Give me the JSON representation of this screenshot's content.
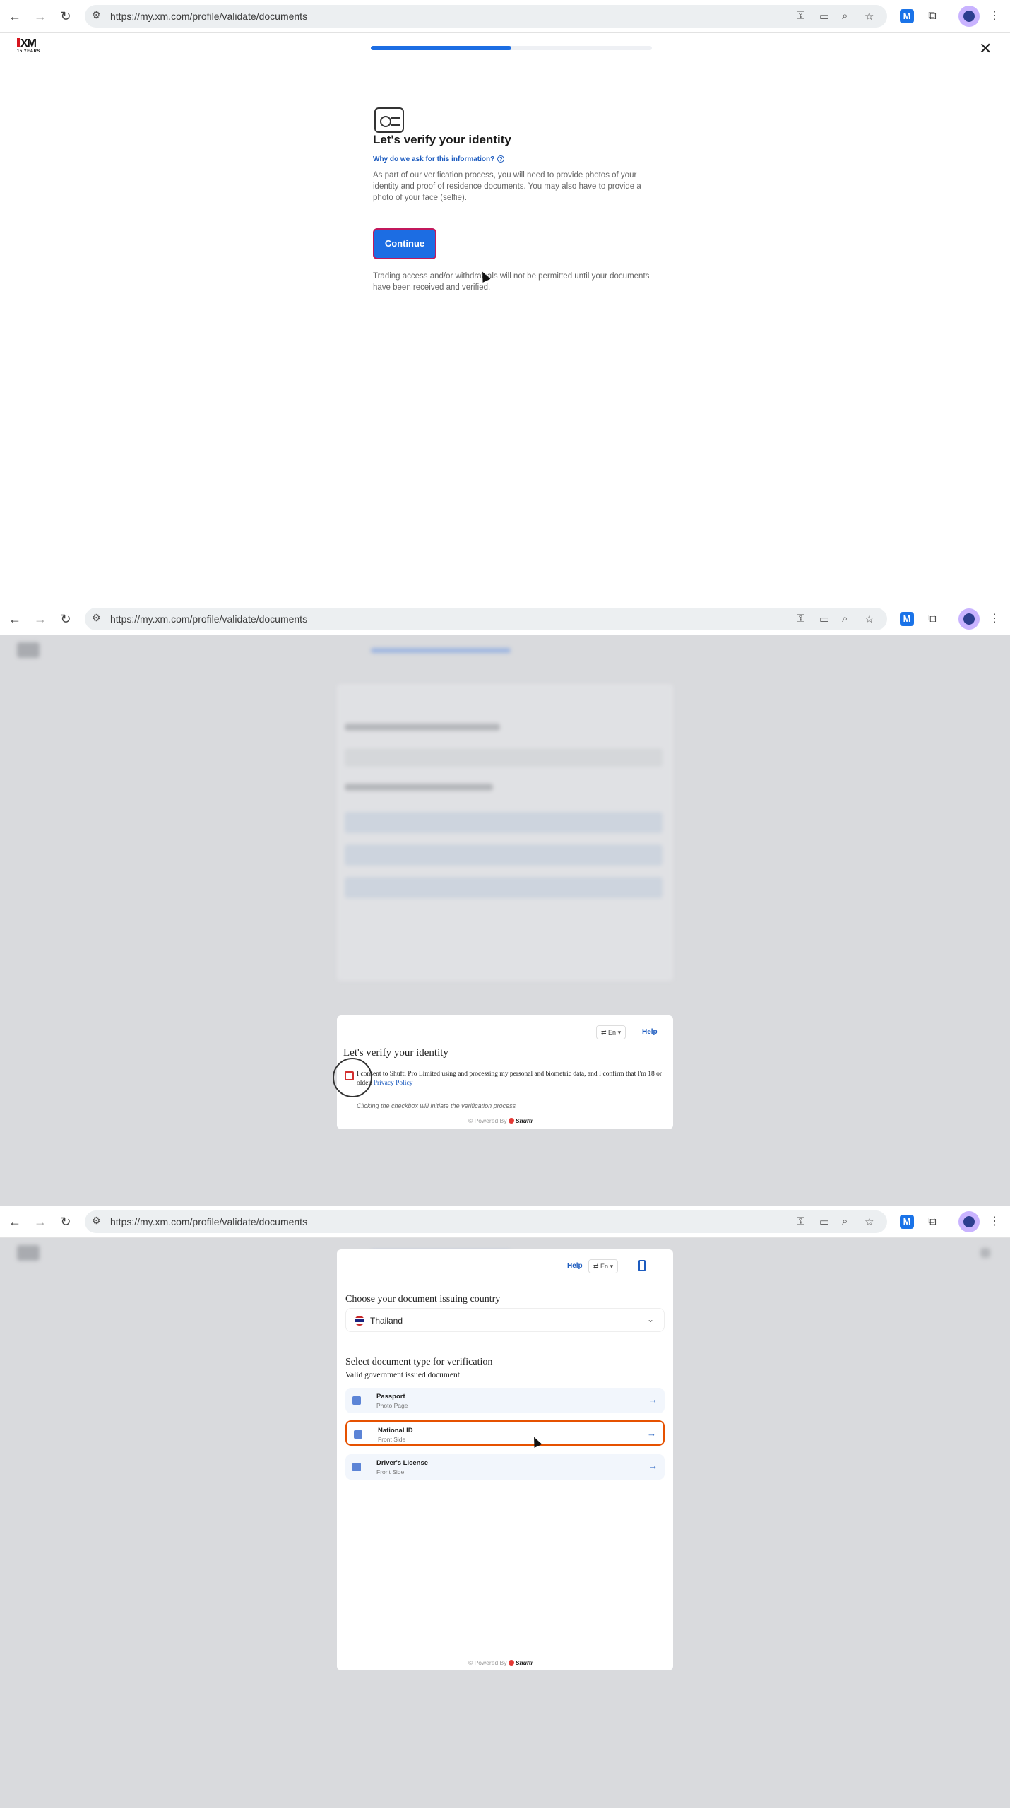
{
  "browser": {
    "url": "https://my.xm.com/profile/validate/documents"
  },
  "xm": {
    "logo_text": "XM",
    "logo_sub": "15 YEARS",
    "progress_percent": 50
  },
  "panel1": {
    "title": "Let's verify your identity",
    "why_link": "Why do we ask for this information?",
    "description": "As part of our verification process, you will need to provide photos of your identity and proof of residence documents. You may also have to provide a photo of your face (selfie).",
    "continue_label": "Continue",
    "note": "Trading access and/or withdrawals will not be permitted until your documents have been received and verified."
  },
  "panel2": {
    "lang_label": "En",
    "help_label": "Help",
    "title": "Let's verify your identity",
    "consent_text": "I consent to Shufti Pro Limited using and processing my personal and biometric data, and I confirm that I'm 18 or older.",
    "privacy_link": "Privacy Policy",
    "hint": "Clicking the checkbox will initiate the verification process",
    "powered_by": "© Powered By",
    "powered_brand": "Shufti"
  },
  "panel3": {
    "help_label": "Help",
    "lang_label": "En",
    "country_heading": "Choose your document issuing country",
    "country_value": "Thailand",
    "doc_heading": "Select document type for verification",
    "doc_subheading": "Valid government issued document",
    "documents": [
      {
        "name": "Passport",
        "side": "Photo Page"
      },
      {
        "name": "National ID",
        "side": "Front Side"
      },
      {
        "name": "Driver's License",
        "side": "Front Side"
      }
    ],
    "powered_by": "© Powered By",
    "powered_brand": "Shufti"
  }
}
